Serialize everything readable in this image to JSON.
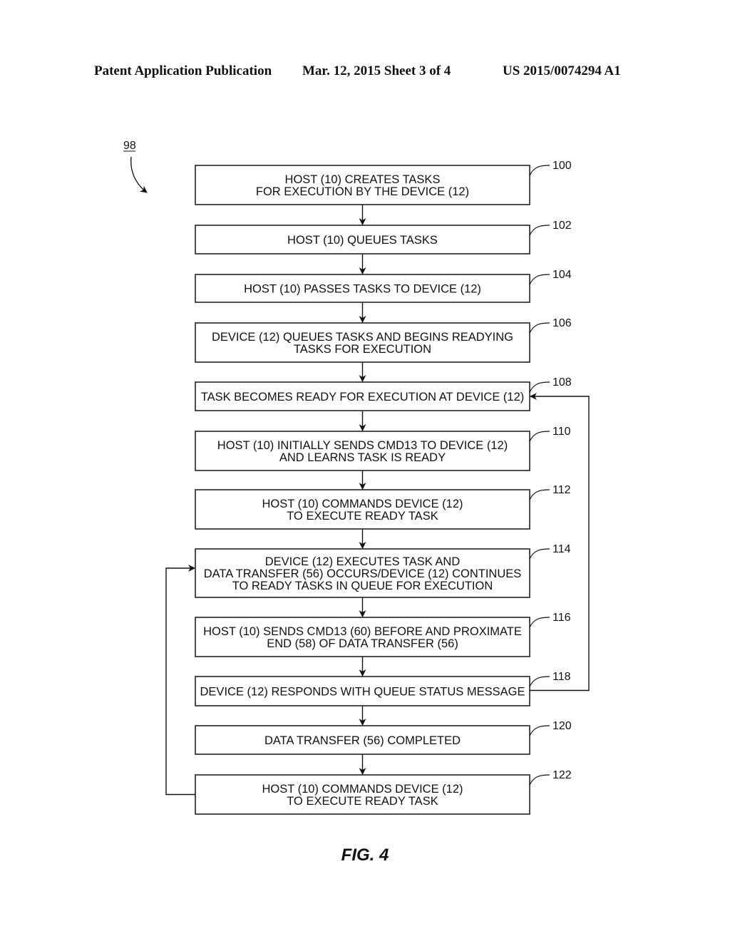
{
  "header": {
    "left": "Patent Application Publication",
    "center": "Mar. 12, 2015  Sheet 3 of 4",
    "right": "US 2015/0074294 A1"
  },
  "diagram": {
    "ref": "98",
    "figure_label": "FIG. 4",
    "steps": [
      {
        "ref": "100",
        "lines": [
          "HOST (10) CREATES TASKS",
          "FOR EXECUTION BY THE DEVICE (12)"
        ]
      },
      {
        "ref": "102",
        "lines": [
          "HOST (10) QUEUES TASKS"
        ]
      },
      {
        "ref": "104",
        "lines": [
          "HOST (10) PASSES TASKS TO DEVICE (12)"
        ]
      },
      {
        "ref": "106",
        "lines": [
          "DEVICE (12) QUEUES TASKS AND BEGINS READYING",
          "TASKS FOR EXECUTION"
        ]
      },
      {
        "ref": "108",
        "lines": [
          "TASK BECOMES READY FOR EXECUTION AT DEVICE (12)"
        ]
      },
      {
        "ref": "110",
        "lines": [
          "HOST (10) INITIALLY SENDS CMD13 TO DEVICE (12)",
          "AND LEARNS TASK IS READY"
        ]
      },
      {
        "ref": "112",
        "lines": [
          "HOST (10) COMMANDS DEVICE (12)",
          "TO EXECUTE READY TASK"
        ]
      },
      {
        "ref": "114",
        "lines": [
          "DEVICE (12) EXECUTES TASK AND",
          "DATA TRANSFER (56) OCCURS/DEVICE (12) CONTINUES",
          "TO READY TASKS IN QUEUE FOR EXECUTION"
        ]
      },
      {
        "ref": "116",
        "lines": [
          "HOST (10) SENDS CMD13 (60) BEFORE AND PROXIMATE",
          "END (58) OF DATA TRANSFER (56)"
        ]
      },
      {
        "ref": "118",
        "lines": [
          "DEVICE (12) RESPONDS WITH QUEUE STATUS MESSAGE"
        ]
      },
      {
        "ref": "120",
        "lines": [
          "DATA TRANSFER (56) COMPLETED"
        ]
      },
      {
        "ref": "122",
        "lines": [
          "HOST (10) COMMANDS DEVICE (12)",
          "TO EXECUTE READY TASK"
        ]
      }
    ],
    "loops": [
      {
        "from": "118",
        "to": "108",
        "side": "right"
      },
      {
        "from": "122",
        "to": "114",
        "side": "left"
      }
    ]
  }
}
